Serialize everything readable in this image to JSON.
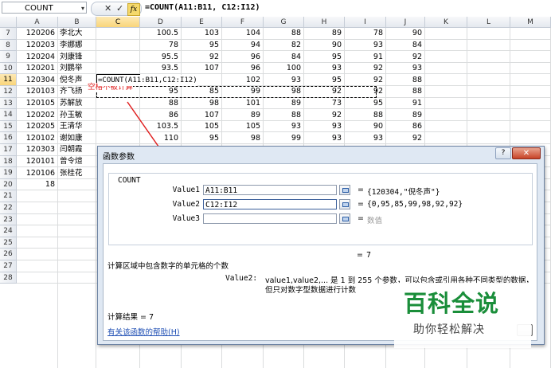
{
  "formula_bar": {
    "name_box": "COUNT",
    "dropdown_icon": "▾",
    "cancel_icon": "✕",
    "enter_icon": "✓",
    "fx_label": "fx",
    "formula": "=COUNT(A11:B11, C12:I12)"
  },
  "columns": [
    "A",
    "B",
    "C",
    "D",
    "E",
    "F",
    "G",
    "H",
    "I",
    "J",
    "K",
    "L",
    "M"
  ],
  "rows": [
    "7",
    "8",
    "9",
    "10",
    "11",
    "12",
    "13",
    "14",
    "15",
    "16",
    "17",
    "18",
    "19",
    "20",
    "21",
    "22",
    "23",
    "24",
    "25",
    "26",
    "27",
    "28"
  ],
  "cells": {
    "r7": [
      "120206",
      "李北大",
      "",
      "100.5",
      "103",
      "104",
      "88",
      "89",
      "78",
      "90"
    ],
    "r8": [
      "120203",
      "李娜娜",
      "",
      "78",
      "95",
      "94",
      "82",
      "90",
      "93",
      "84"
    ],
    "r9": [
      "120204",
      "刘康锋",
      "",
      "95.5",
      "92",
      "96",
      "84",
      "95",
      "91",
      "92"
    ],
    "r10": [
      "120201",
      "刘鹏举",
      "",
      "93.5",
      "107",
      "96",
      "100",
      "93",
      "92",
      "93"
    ],
    "r11": [
      "120304",
      "倪冬声",
      "=COUNT(A11:B11,C12:I12)",
      "",
      "",
      "102",
      "93",
      "95",
      "92",
      "88"
    ],
    "r12": [
      "120103",
      "齐飞扬",
      "",
      "95",
      "85",
      "99",
      "98",
      "92",
      "92",
      "88"
    ],
    "r13": [
      "120105",
      "苏解放",
      "",
      "88",
      "98",
      "101",
      "89",
      "73",
      "95",
      "91"
    ],
    "r14": [
      "120202",
      "孙玉敏",
      "",
      "86",
      "107",
      "89",
      "88",
      "92",
      "88",
      "89"
    ],
    "r15": [
      "120205",
      "王清华",
      "",
      "103.5",
      "105",
      "105",
      "93",
      "93",
      "90",
      "86"
    ],
    "r16": [
      "120102",
      "谢如康",
      "",
      "110",
      "95",
      "98",
      "99",
      "93",
      "93",
      "92"
    ],
    "r17": [
      "120303",
      "闫朝霞",
      "",
      "",
      "",
      "",
      "",
      "",
      "",
      ""
    ],
    "r18": [
      "120101",
      "曾令煊",
      "",
      "",
      "",
      "",
      "",
      "",
      "",
      ""
    ],
    "r19": [
      "120106",
      "张桂花",
      "",
      "",
      "",
      "",
      "",
      "",
      "",
      ""
    ],
    "r20": [
      "18",
      "",
      "",
      "",
      "",
      "",
      "",
      "",
      "",
      ""
    ]
  },
  "annotation": "空格不被计算",
  "dialog": {
    "title": "函数参数",
    "help_icon": "?",
    "close_icon": "✕",
    "function_name": "COUNT",
    "params": [
      {
        "label": "Value1",
        "value": "A11:B11",
        "result": "{120304,\"倪冬声\"}"
      },
      {
        "label": "Value2",
        "value": "C12:I12",
        "result": "{0,95,85,99,98,92,92}"
      },
      {
        "label": "Value3",
        "value": "",
        "result": "数值"
      }
    ],
    "equals": "=",
    "result_value": "7",
    "description": "计算区域中包含数字的单元格的个数",
    "param_desc_name": "Value2:",
    "param_desc_line1": "value1,value2,... 是 1 到 255 个参数，可以包含或引用各种不同类型的数据，",
    "param_desc_line2": "但只对数字型数据进行计数",
    "calc_result": "计算结果 =  7",
    "help_link": "有关该函数的帮助(H)"
  },
  "watermark": {
    "main": "百科全说",
    "sub": "助你轻松解决"
  }
}
